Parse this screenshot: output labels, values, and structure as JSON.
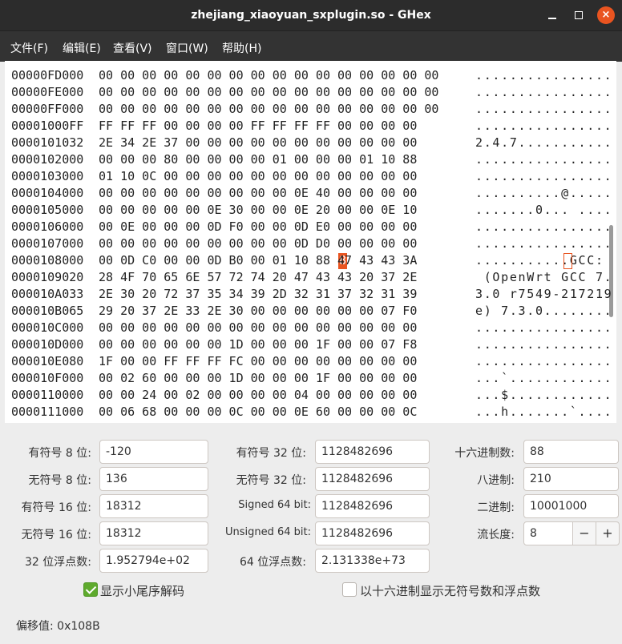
{
  "window": {
    "title": "zhejiang_xiaoyuan_sxplugin.so - GHex",
    "close_glyph": "×"
  },
  "menu": [
    "文件(F)",
    "编辑(E)",
    "查看(V)",
    "窗口(W)",
    "帮助(H)"
  ],
  "hex_rows": [
    {
      "offset": "00000FD000",
      "hex": "00 00 00 00 00 00 00 00 00 00 00 00 00 00 00 00",
      "ascii": "................"
    },
    {
      "offset": "00000FE000",
      "hex": "00 00 00 00 00 00 00 00 00 00 00 00 00 00 00 00",
      "ascii": "................"
    },
    {
      "offset": "00000FF000",
      "hex": "00 00 00 00 00 00 00 00 00 00 00 00 00 00 00 00",
      "ascii": "................"
    },
    {
      "offset": "00001000FF",
      "hex": "FF FF FF 00 00 00 00 FF FF FF FF 00 00 00 00",
      "ascii": "................"
    },
    {
      "offset": "0000101032",
      "hex": "2E 34 2E 37 00 00 00 00 00 00 00 00 00 00 00",
      "ascii": "2.4.7..........."
    },
    {
      "offset": "0000102000",
      "hex": "00 00 00 80 00 00 00 00 01 00 00 00 01 10 88",
      "ascii": "................"
    },
    {
      "offset": "0000103000",
      "hex": "01 10 0C 00 00 00 00 00 00 00 00 00 00 00 00",
      "ascii": "................"
    },
    {
      "offset": "0000104000",
      "hex": "00 00 00 00 00 00 00 00 00 0E 40 00 00 00 00",
      "ascii": "..........@....."
    },
    {
      "offset": "0000105000",
      "hex": "00 00 00 00 00 0E 30 00 00 0E 20 00 00 0E 10",
      "ascii": ".......0... ...."
    },
    {
      "offset": "0000106000",
      "hex": "00 0E 00 00 00 0D F0 00 00 0D E0 00 00 00 00",
      "ascii": "................"
    },
    {
      "offset": "0000107000",
      "hex": "00 00 00 00 00 00 00 00 00 0D D0 00 00 00 00",
      "ascii": "................"
    },
    {
      "offset": "0000108000",
      "hex": "00 0D C0 00 00 0D B0 00 01 10 88 47 43 43 3A",
      "ascii": "...........GCC:"
    },
    {
      "offset": "0000109020",
      "hex": "28 4F 70 65 6E 57 72 74 20 47 43 43 20 37 2E",
      "ascii": " (OpenWrt GCC 7."
    },
    {
      "offset": "000010A033",
      "hex": "2E 30 20 72 37 35 34 39 2D 32 31 37 32 31 39",
      "ascii": "3.0 r7549-217219"
    },
    {
      "offset": "000010B065",
      "hex": "29 20 37 2E 33 2E 30 00 00 00 00 00 00 07 F0",
      "ascii": "e) 7.3.0........"
    },
    {
      "offset": "000010C000",
      "hex": "00 00 00 00 00 00 00 00 00 00 00 00 00 00 00",
      "ascii": "................"
    },
    {
      "offset": "000010D000",
      "hex": "00 00 00 00 00 00 1D 00 00 00 1F 00 00 07 F8",
      "ascii": "................"
    },
    {
      "offset": "000010E080",
      "hex": "1F 00 00 FF FF FF FC 00 00 00 00 00 00 00 00",
      "ascii": "................"
    },
    {
      "offset": "000010F000",
      "hex": "00 02 60 00 00 00 1D 00 00 00 1F 00 00 00 00",
      "ascii": "...`............"
    },
    {
      "offset": "0000110000",
      "hex": "00 00 24 00 02 00 00 00 00 04 00 00 00 00 00",
      "ascii": "...$............"
    },
    {
      "offset": "0000111000",
      "hex": "00 06 68 00 00 00 0C 00 00 0E 60 00 00 00 0C",
      "ascii": "...h.......`...."
    }
  ],
  "highlight": {
    "hex_char": "8",
    "ascii_char": "."
  },
  "converter": {
    "signed8_label": "有符号 8 位:",
    "signed8": "-120",
    "unsigned8_label": "无符号 8 位:",
    "unsigned8": "136",
    "signed16_label": "有符号 16 位:",
    "signed16": "18312",
    "unsigned16_label": "无符号 16 位:",
    "unsigned16": "18312",
    "float32_label": "32 位浮点数:",
    "float32": "1.952794e+02",
    "signed32_label": "有符号 32 位:",
    "signed32": "1128482696",
    "unsigned32_label": "无符号 32 位:",
    "unsigned32": "1128482696",
    "signed64_label": "Signed 64 bit:",
    "signed64": "1128482696",
    "unsigned64_label": "Unsigned 64 bit:",
    "unsigned64": "1128482696",
    "float64_label": "64 位浮点数:",
    "float64": "2.131338e+73",
    "hex_label": "十六进制数:",
    "hex": "88",
    "oct_label": "八进制:",
    "oct": "210",
    "bin_label": "二进制:",
    "bin": "10001000",
    "stream_label": "流长度:",
    "stream": "8",
    "minus": "−",
    "plus": "+"
  },
  "options": {
    "little_endian_label": "显示小尾序解码",
    "little_endian_checked": true,
    "hex_unsigned_label": "以十六进制显示无符号数和浮点数",
    "hex_unsigned_checked": false
  },
  "status": {
    "offset": "偏移值: 0x108B"
  },
  "colors": {
    "accent": "#e95420",
    "check": "#5eaa2d"
  }
}
